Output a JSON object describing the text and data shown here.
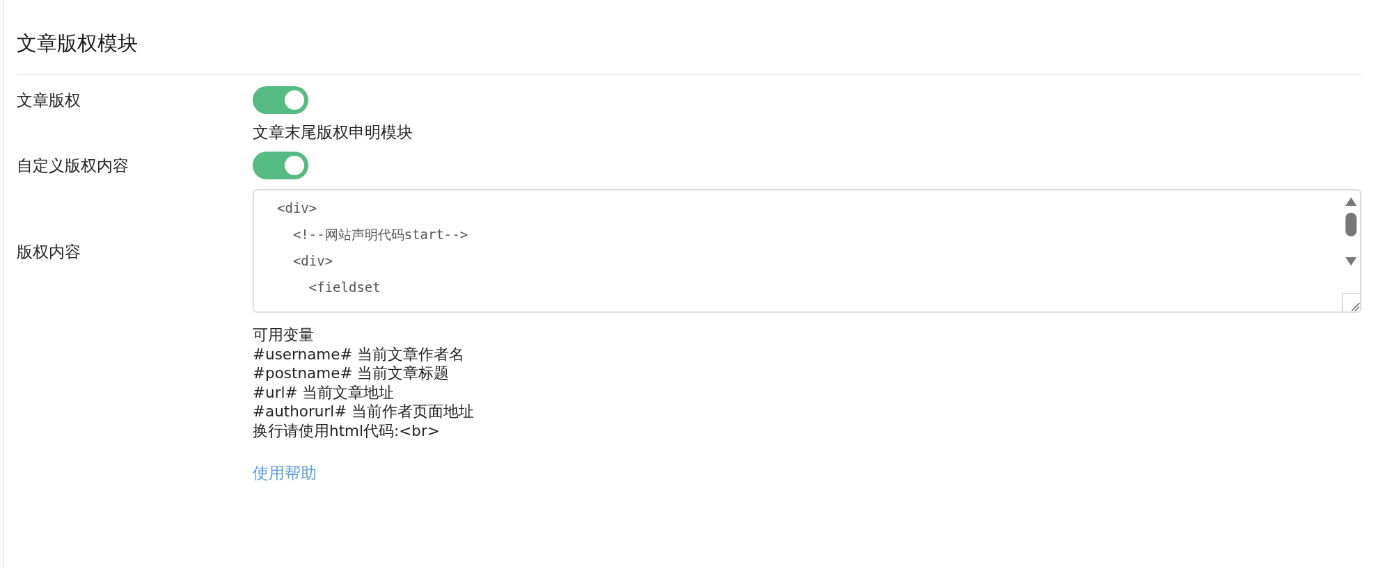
{
  "section": {
    "title": "文章版权模块"
  },
  "fields": [
    {
      "kind": "switch",
      "label": "文章版权",
      "on": true,
      "description": "文章末尾版权申明模块"
    },
    {
      "kind": "switch",
      "label": "自定义版权内容",
      "on": true
    },
    {
      "kind": "code",
      "label": "版权内容",
      "lines": [
        "<div>",
        "  <!--网站声明代码start-->",
        "  <div>",
        "    <fieldset"
      ],
      "help": [
        "可用变量",
        "#username# 当前文章作者名",
        "#postname# 当前文章标题",
        "#url# 当前文章地址",
        "#authorurl# 当前作者页面地址",
        "换行请使用html代码:<br>"
      ],
      "link": "使用帮助"
    }
  ]
}
